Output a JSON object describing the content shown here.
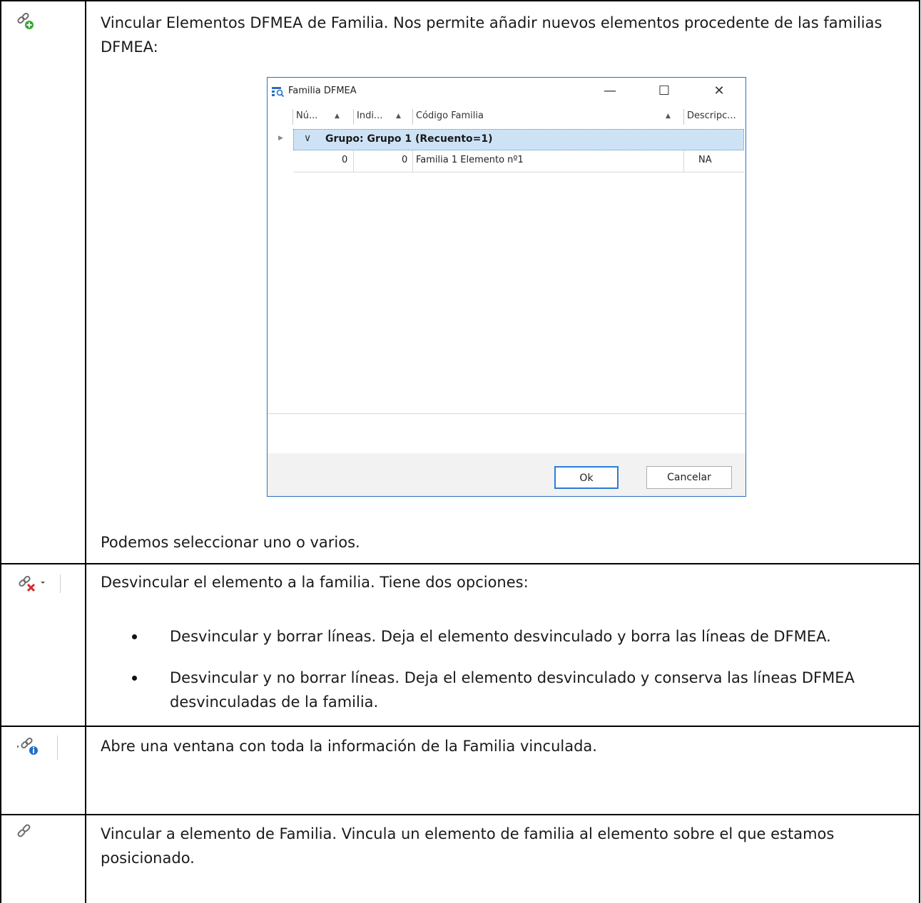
{
  "rows": [
    {
      "icon": "link-add-icon",
      "intro": "Vincular Elementos DFMEA de Familia. Nos permite añadir nuevos elementos procedente de las familias DFMEA:",
      "outro": "Podemos seleccionar uno o varios."
    },
    {
      "icon": "link-remove-dropdown-icon",
      "intro": "Desvincular el elemento a la familia. Tiene dos opciones:",
      "bullets": [
        "Desvincular y borrar líneas. Deja el elemento desvinculado y borra las líneas de DFMEA.",
        "Desvincular y no borrar líneas. Deja el elemento desvinculado y conserva las líneas DFMEA desvinculadas de la familia."
      ]
    },
    {
      "icon": "link-info-icon",
      "intro": "Abre una ventana con toda la información de la Familia vinculada."
    },
    {
      "icon": "link-icon",
      "intro": "Vincular a elemento de Familia. Vincula un elemento de familia al elemento sobre el que estamos posicionado."
    }
  ],
  "dialog": {
    "title": "Familia DFMEA",
    "columns": [
      "Nú...",
      "Indi...",
      "Código Familia",
      "Descripc..."
    ],
    "group_label": "Grupo: Grupo 1 (Recuento=1)",
    "row": {
      "num": "0",
      "ind": "0",
      "codigo": "Familia 1 Elemento nº1",
      "descripcion": "NA"
    },
    "ok_label": "Ok",
    "cancel_label": "Cancelar",
    "minimize": "—",
    "maximize": "☐",
    "close": "✕"
  }
}
